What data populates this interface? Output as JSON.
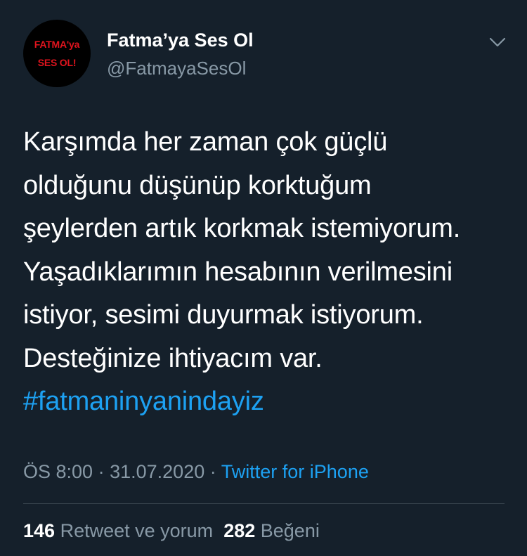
{
  "author": {
    "avatar_text_line1": "FATMA'ya",
    "avatar_text_line2": "SES OL!",
    "display_name": "Fatma’ya Ses Ol",
    "handle": "@FatmayaSesOl"
  },
  "tweet": {
    "lines": [
      "Karşımda her zaman çok güçlü",
      "olduğunu düşünüp korktuğum",
      "şeylerden artık korkmak istemiyorum.",
      "Yaşadıklarımın hesabının verilmesini",
      "istiyor, sesimi duyurmak istiyorum.",
      "Desteğinize ihtiyacım var."
    ],
    "hashtag": "#fatmaninyanindayiz"
  },
  "meta": {
    "time": "ÖS 8:00",
    "separator": "·",
    "date": "31.07.2020",
    "source": "Twitter for iPhone"
  },
  "stats": {
    "retweets_count": "146",
    "retweets_label": "Retweet ve yorum",
    "likes_count": "282",
    "likes_label": "Beğeni"
  },
  "colors": {
    "background": "#15202b",
    "primary_text": "#ffffff",
    "secondary_text": "#8899a6",
    "accent": "#1da1f2",
    "divider": "#38444d",
    "avatar_text": "#e0141e"
  },
  "icons": {
    "more": "chevron-down-icon"
  }
}
